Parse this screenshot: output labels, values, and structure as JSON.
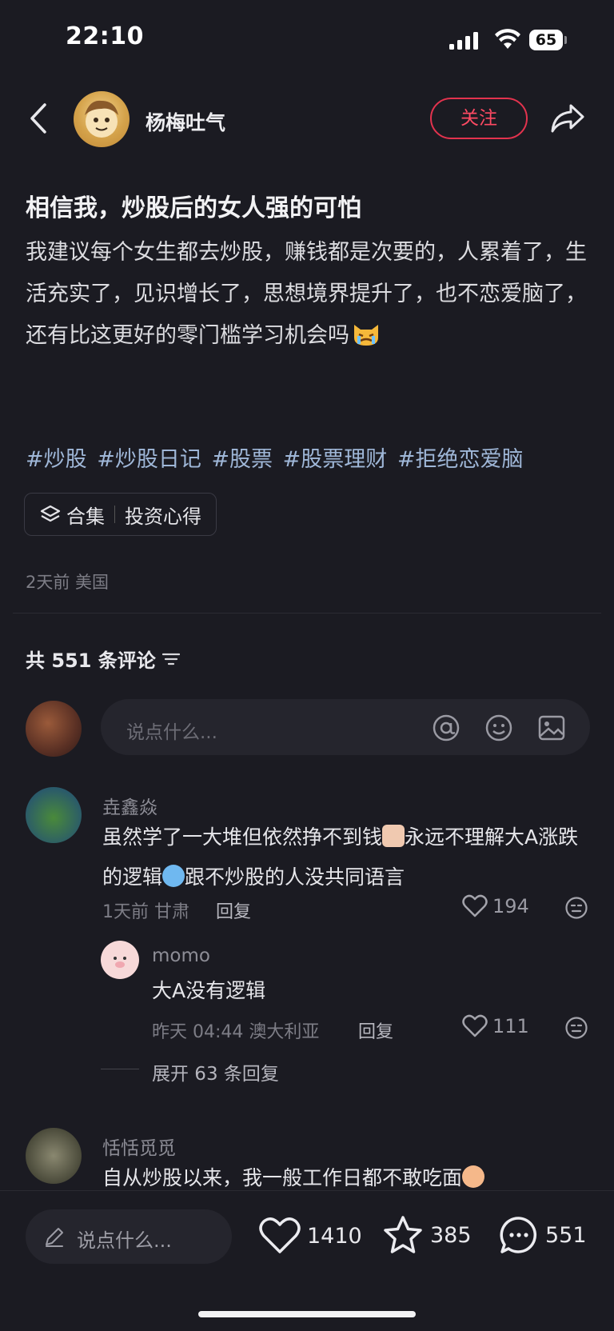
{
  "status_bar": {
    "time": "22:10",
    "battery": "65"
  },
  "header": {
    "author_name": "杨梅吐气",
    "follow_label": "关注"
  },
  "post": {
    "title": "相信我，炒股后的女人强的可怕",
    "body": "我建议每个女生都去炒股，赚钱都是次要的，人累着了，生活充实了，见识增长了，思想境界提升了，也不恋爱脑了，还有比这更好的零门槛学习机会吗",
    "tags": [
      "#炒股",
      "#炒股日记",
      "#股票",
      "#股票理财",
      "#拒绝恋爱脑"
    ],
    "collection_label": "合集",
    "collection_name": "投资心得",
    "meta": "2天前 美国"
  },
  "comments_header": {
    "count_text": "共 551 条评论"
  },
  "comment_input": {
    "placeholder": "说点什么..."
  },
  "comments": [
    {
      "name": "垚鑫焱",
      "text_part1": "虽然学了一大堆但依然挣不到钱",
      "text_part2": "永远不理解大A涨跌的逻辑",
      "text_part3": "跟不炒股的人没共同语言",
      "meta": "1天前 甘肃",
      "reply_label": "回复",
      "likes": "194"
    },
    {
      "name": "momo",
      "text": "大A没有逻辑",
      "meta": "昨天 04:44 澳大利亚",
      "reply_label": "回复",
      "likes": "111"
    },
    {
      "name": "恬恬觅觅",
      "text": "自从炒股以来，我一般工作日都不敢吃面"
    }
  ],
  "expand_replies": "展开 63 条回复",
  "bottom_bar": {
    "placeholder": "说点什么...",
    "likes": "1410",
    "stars": "385",
    "comments": "551"
  },
  "colors": {
    "accent": "#ff4a63",
    "tag": "#9fb7d8",
    "background": "#1b1b22"
  }
}
